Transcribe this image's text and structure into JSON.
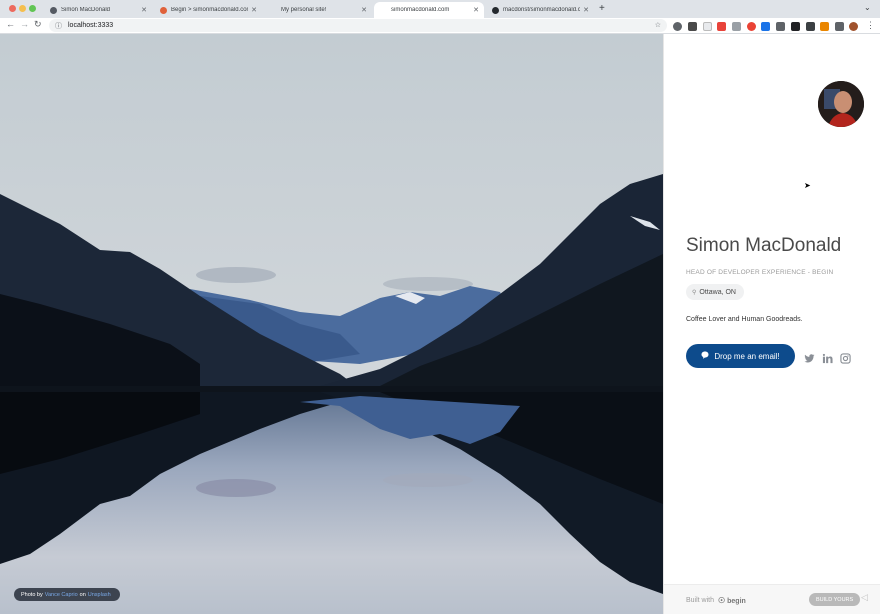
{
  "browser": {
    "tabs": [
      {
        "label": "Simon MacDonald",
        "icon_color": "#555a63"
      },
      {
        "label": "Begin > simonmacdonald.com",
        "icon_color": "#e0613a"
      },
      {
        "label": "My personal site!",
        "icon_color": "#4a88d8"
      },
      {
        "label": "simonmacdonald.com",
        "icon_color": "#4a88d8"
      },
      {
        "label": "macdonst/simonmacdonald.com",
        "icon_color": "#222222"
      }
    ],
    "new_tab_icon": "plus-icon",
    "address": "localhost:3333"
  },
  "hero": {
    "credit_prefix": "Photo by",
    "photographer": "Vance Caprio",
    "credit_on": "on",
    "source": "Unsplash"
  },
  "profile": {
    "name": "Simon MacDonald",
    "role": "HEAD OF DEVELOPER EXPERIENCE - BEGIN",
    "location": "Ottawa, ON",
    "bio": "Coffee Lover and Human Goodreads.",
    "email_button": "Drop me an email!",
    "social": [
      "twitter-icon",
      "linkedin-icon",
      "instagram-icon"
    ]
  },
  "footer": {
    "built_with": "Built with",
    "brand": "begin",
    "build_button": "BUILD YOURS"
  },
  "colors": {
    "accent": "#0d4b8c",
    "tabbar": "#dfe3e8"
  }
}
